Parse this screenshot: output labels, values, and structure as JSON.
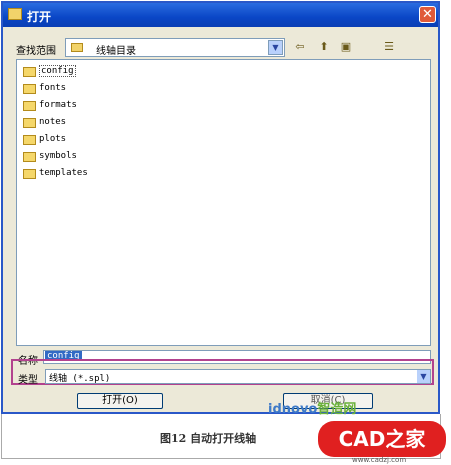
{
  "dialog": {
    "title": "打开",
    "close_glyph": "✕",
    "look_in_label": "查找范围",
    "look_in_value": "线轴目录",
    "toolbar": [
      {
        "name": "back-icon",
        "glyph": "⇦"
      },
      {
        "name": "up-folder-icon",
        "glyph": "⬆"
      },
      {
        "name": "new-folder-icon",
        "glyph": "▣"
      },
      {
        "name": "view-menu-icon",
        "glyph": "☰"
      }
    ],
    "files": [
      {
        "name": "config",
        "selected": true
      },
      {
        "name": "fonts"
      },
      {
        "name": "formats"
      },
      {
        "name": "notes"
      },
      {
        "name": "plots"
      },
      {
        "name": "symbols"
      },
      {
        "name": "templates"
      }
    ],
    "filename_label": "名称",
    "filename_value": "config",
    "filetype_label": "类型",
    "filetype_value": "线轴 (*.spl)",
    "open_button": "打开(O)",
    "cancel_button": "取消(C)"
  },
  "caption": "图12  自动打开线轴",
  "watermark": {
    "site": "idnovo",
    "site_cn": "智造网",
    "logo": "CAD之家",
    "url": "www.cadzj.com"
  }
}
